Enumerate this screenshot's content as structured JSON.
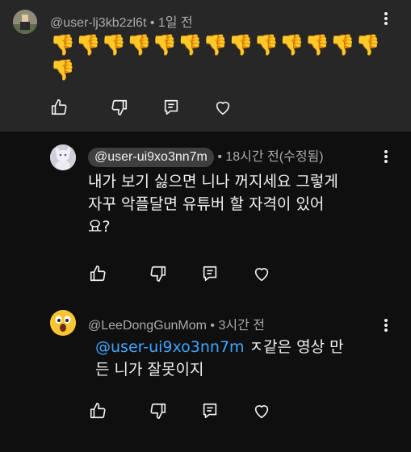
{
  "comments": [
    {
      "handle": "@user-lj3kb2zl6t",
      "time": "1일 전",
      "emoji": "👎",
      "emoji_count": 14,
      "body": ""
    },
    {
      "handle": "@user-ui9xo3nn7m",
      "time": "18시간 전(수정됨)",
      "body_line1": "내가 보기 싫으면 니나 꺼지세요 그렇게",
      "body_line2": "자꾸 악플달면 유튜버 할 자격이 있어",
      "body_line3": "요?"
    },
    {
      "handle": "@LeeDongGunMom",
      "time": "3시간 전",
      "mention": "@user-ui9xo3nn7m",
      "body_line1_rest": " ㅈ같은 영상 만",
      "body_line2": "든 니가 잘못이지"
    }
  ],
  "separator": " • ",
  "colors": {
    "top_bg": "#272727",
    "page_bg": "#0f0f0f",
    "mention": "#3ea6ff",
    "meta": "#aaaaaa"
  },
  "icons": [
    "like-icon",
    "dislike-icon",
    "reply-icon",
    "heart-icon",
    "more-icon"
  ]
}
